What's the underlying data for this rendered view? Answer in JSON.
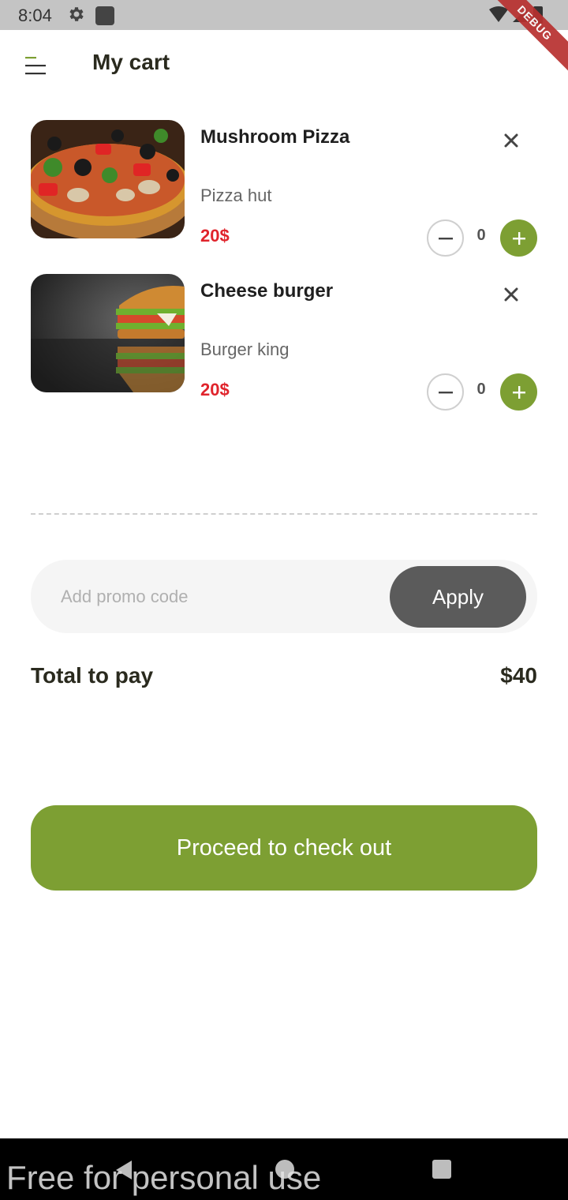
{
  "status_bar": {
    "time": "8:04",
    "debug_label": "DEBUG"
  },
  "header": {
    "title": "My cart",
    "menu_icon": "menu-icon"
  },
  "cart": {
    "items": [
      {
        "name": "Mushroom Pizza",
        "store": "Pizza hut",
        "price": "20$",
        "quantity": "0",
        "minus_label": "−",
        "plus_label": "+"
      },
      {
        "name": "Cheese burger",
        "store": "Burger king",
        "price": "20$",
        "quantity": "0",
        "minus_label": "−",
        "plus_label": "+"
      }
    ]
  },
  "promo": {
    "placeholder": "Add promo code",
    "value": "",
    "apply_label": "Apply"
  },
  "total": {
    "label": "Total to pay",
    "value": "$40"
  },
  "checkout": {
    "label": "Proceed to check out"
  },
  "watermark": "Free for personal use",
  "colors": {
    "accent_green": "#7d9f33",
    "price_red": "#e0242c",
    "apply_gray": "#5b5b5b",
    "promo_bg": "#f5f5f5"
  }
}
